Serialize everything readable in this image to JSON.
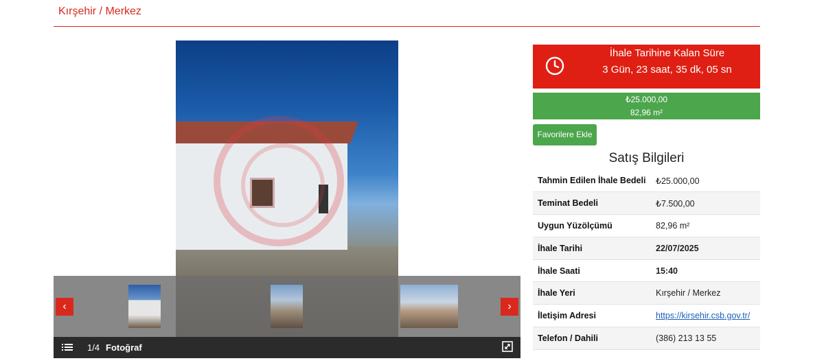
{
  "header": {
    "location": "Kırşehir / Merkez"
  },
  "gallery": {
    "counter": "1/4",
    "caption": "Fotoğraf",
    "prev_label": "‹",
    "next_label": "›"
  },
  "timer": {
    "title": "İhale Tarihine Kalan Süre",
    "value": "3 Gün, 23 saat, 35 dk, 05 sn",
    "color": "#df1f14"
  },
  "pricebox": {
    "price": "₺25.000,00",
    "area": "82,96 m²",
    "color": "#4ca64c"
  },
  "favorite_button": {
    "label": "Favorilere Ekle"
  },
  "sales": {
    "title": "Satış Bilgileri",
    "rows": [
      {
        "label": "Tahmin Edilen İhale Bedeli",
        "value": "₺25.000,00"
      },
      {
        "label": "Teminat Bedeli",
        "value": "₺7.500,00"
      },
      {
        "label": "Uygun Yüzölçümü",
        "value": "82,96 m²"
      },
      {
        "label": "İhale Tarihi",
        "value": "22/07/2025"
      },
      {
        "label": "İhale Saati",
        "value": "15:40"
      },
      {
        "label": "İhale Yeri",
        "value": "Kırşehir / Merkez"
      },
      {
        "label": "İletişim Adresi",
        "value": "https://kirsehir.csb.gov.tr/"
      },
      {
        "label": "Telefon / Dahili",
        "value": "(386) 213 13 55"
      }
    ]
  },
  "accent_color": "#d9291c"
}
